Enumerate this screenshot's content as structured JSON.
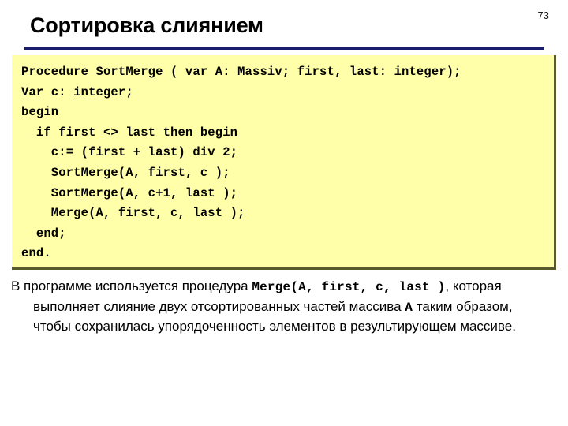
{
  "slide": {
    "page_number": "73",
    "title": "Сортировка слиянием",
    "accent_color": "#1c1c6e",
    "code_background": "#ffffaa",
    "code_border": "#59592e",
    "text_color": "#000000"
  },
  "code_block": {
    "language": "pascal",
    "lines": [
      "Procedure SortMerge ( var A: Massiv; first, last: integer);",
      "Var c: integer;",
      "begin",
      "  if first <> last then begin",
      "    c:= (first + last) div 2;",
      "    SortMerge(A, first, c );",
      "    SortMerge(A, c+1, last );",
      "    Merge(A, first, c, last );",
      "  end;",
      "end."
    ]
  },
  "body": {
    "segments": [
      {
        "kind": "text",
        "value": "В программе используется процедура "
      },
      {
        "kind": "code",
        "value": "Merge(A, first, c, last )"
      },
      {
        "kind": "text",
        "value": ", которая выполняет слияние двух отсортированных частей массива "
      },
      {
        "kind": "code",
        "value": "A"
      },
      {
        "kind": "text",
        "value": " таким образом, чтобы сохранилась упорядоченность элементов в результирующем массиве."
      }
    ],
    "plain_text": "В программе используется процедура Merge(A, first, c, last ), которая выполняет слияние двух отсортированных частей массива A таким образом, чтобы сохранилась упорядоченность элементов в результирующем массиве."
  }
}
